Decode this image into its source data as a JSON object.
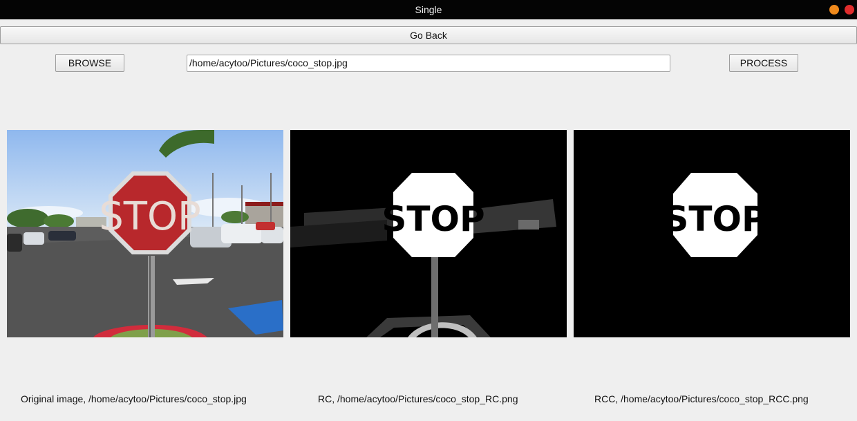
{
  "window": {
    "title": "Single"
  },
  "toolbar": {
    "go_back_label": "Go Back",
    "browse_label": "BROWSE",
    "process_label": "PROCESS",
    "path_value": "/home/acytoo/Pictures/coco_stop.jpg"
  },
  "images": {
    "original_sign_text": "STOP",
    "rc_sign_text": "STOP",
    "rcc_sign_text": "STOP"
  },
  "captions": [
    {
      "text": "Original image, /home/acytoo/Pictures/coco_stop.jpg"
    },
    {
      "text": "RC, /home/acytoo/Pictures/coco_stop_RC.png"
    },
    {
      "text": "RCC, /home/acytoo/Pictures/coco_stop_RCC.png"
    }
  ],
  "colors": {
    "titlebar": "#040404",
    "minimize": "#f08a1c",
    "close": "#e02d2d",
    "stop_red": "#b8282c"
  }
}
